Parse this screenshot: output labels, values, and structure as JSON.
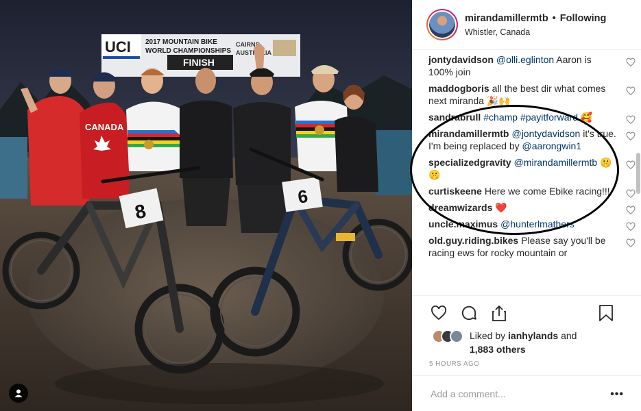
{
  "header": {
    "username": "mirandamillermtb",
    "separator": "•",
    "follow_status": "Following",
    "location": "Whistler, Canada"
  },
  "photo": {
    "banner_line1": "2017 MOUNTAIN BIKE",
    "banner_line2": "WORLD CHAMPIONSHIPS",
    "banner_logo": "UCI",
    "finish_text": "FINISH",
    "side_banner_line1": "CAIRNS",
    "side_banner_line2": "AUSTRALIA",
    "left_shirt_text": "CANADA",
    "plate_left": "8",
    "plate_right": "6"
  },
  "comments": [
    {
      "user": "jontydavidson",
      "mention": "@olli.eglinton",
      "text": "Aaron is 100% join"
    },
    {
      "user": "maddogboris",
      "mention": "",
      "text": "all the best dir what comes next miranda 🎉🙌"
    },
    {
      "user": "sandrabrull",
      "mention": "#champ #payitforward",
      "text": "🥰"
    },
    {
      "user": "mirandamillermtb",
      "mention": "@jontydavidson",
      "text": "it's true. I'm being replaced by",
      "mention2": "@aarongwin1"
    },
    {
      "user": "specializedgravity",
      "mention": "@mirandamillermtb",
      "text": "🤫🤫"
    },
    {
      "user": "curtiskeene",
      "mention": "",
      "text": "Here we come Ebike racing!!!"
    },
    {
      "user": "dreamwizards",
      "mention": "",
      "text": "❤️"
    },
    {
      "user": "uncle.maximus",
      "mention": "@hunterlmathers",
      "text": ""
    },
    {
      "user": "old.guy.riding.bikes",
      "mention": "",
      "text": "Please say you'll be racing ews for rocky mountain or"
    }
  ],
  "likes": {
    "prefix": "Liked by",
    "user": "ianhylands",
    "conj": "and",
    "count": "1,883 others"
  },
  "time": "5 HOURS AGO",
  "add_comment": {
    "placeholder": "Add a comment..."
  },
  "more": "•••",
  "colors": {
    "mention": "#003569",
    "ellipse": "#000000",
    "heart_red": "#ed4956",
    "border": "#efefef"
  }
}
